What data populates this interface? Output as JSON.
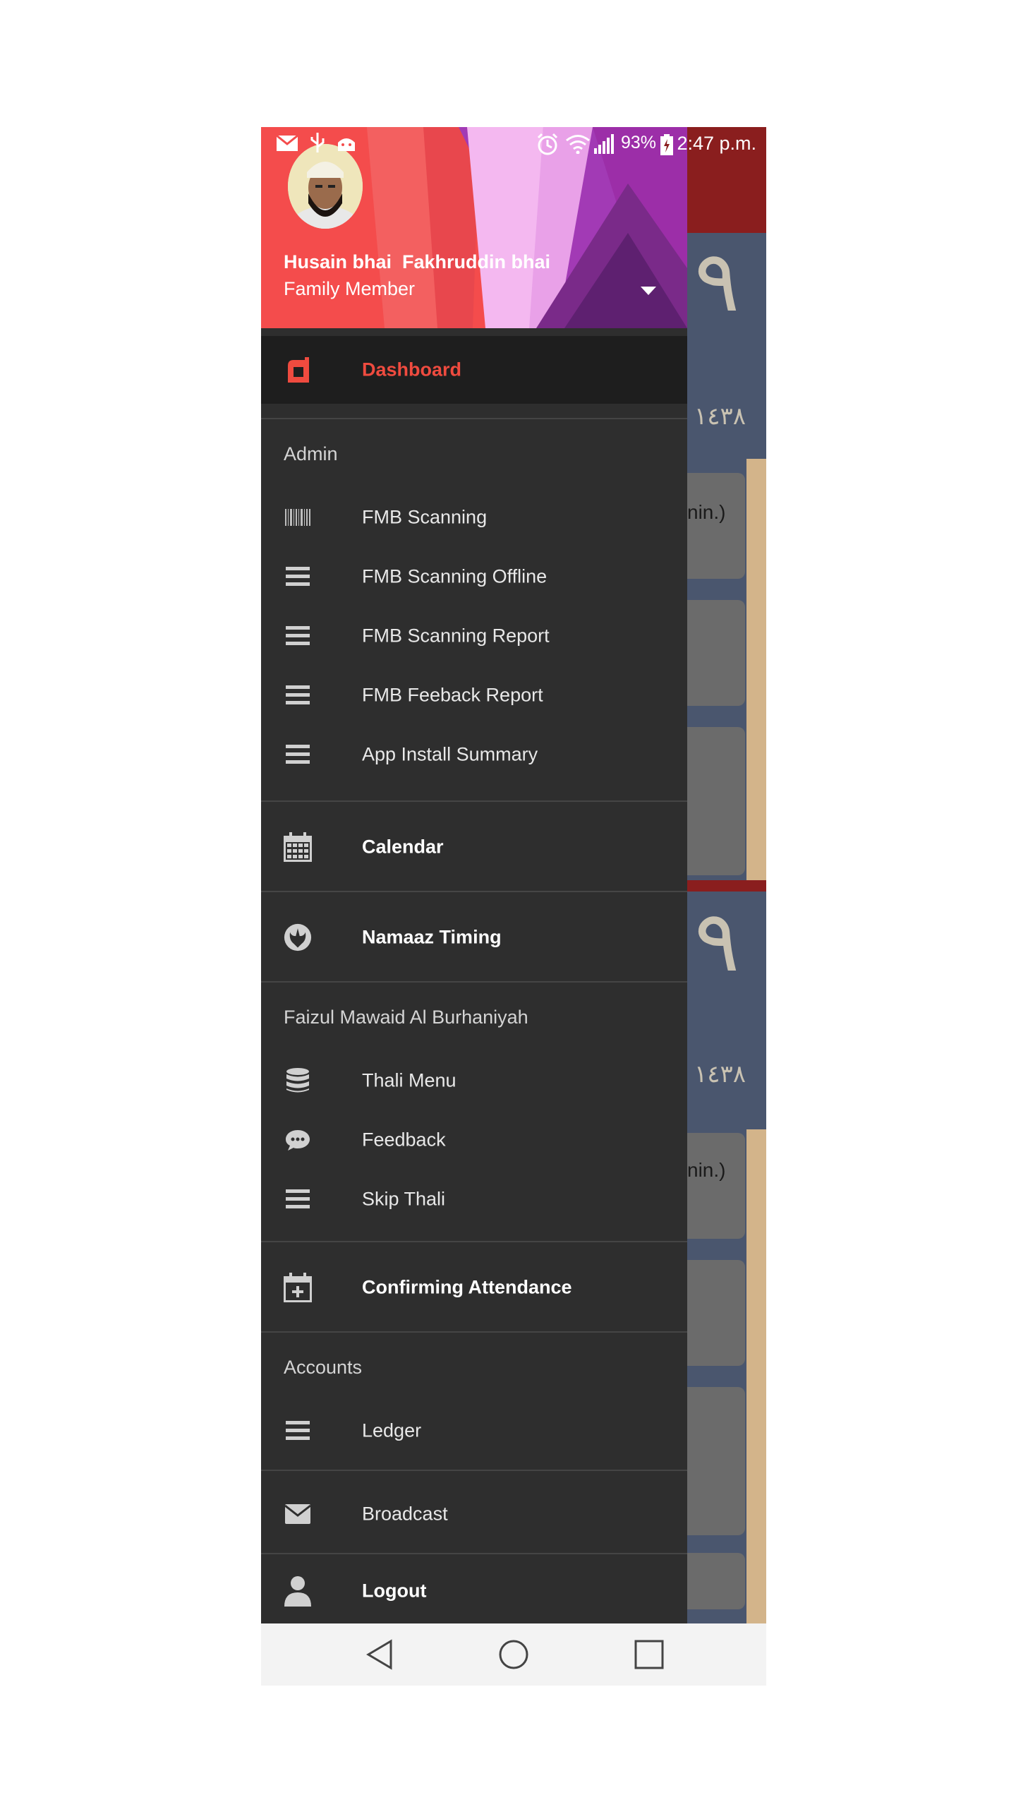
{
  "status_bar": {
    "battery": "93%",
    "time": "2:47 p.m."
  },
  "header": {
    "name": "Husain bhai  Fakhruddin bhai",
    "role": "Family Member"
  },
  "menu": {
    "dashboard": "Dashboard",
    "admin_section": "Admin",
    "fmb_scanning": "FMB Scanning",
    "fmb_scanning_offline": "FMB Scanning Offline",
    "fmb_scanning_report": "FMB Scanning Report",
    "fmb_feedback_report": "FMB Feeback Report",
    "app_install_summary": "App Install Summary",
    "calendar": "Calendar",
    "namaaz_timing": "Namaaz Timing",
    "faiz_section": "Faizul Mawaid Al Burhaniyah",
    "thali_menu": "Thali Menu",
    "feedback": "Feedback",
    "skip_thali": "Skip Thali",
    "confirming_attendance": "Confirming Attendance",
    "accounts_section": "Accounts",
    "ledger": "Ledger",
    "broadcast": "Broadcast",
    "logout": "Logout"
  },
  "background_app": {
    "glyph": "٩",
    "year_text": "١٤٣٨",
    "card_text": "nin.)"
  },
  "colors": {
    "accent": "#ef4b3f",
    "drawer_bg": "#2e2e2e",
    "header_red": "#f44c4c",
    "header_purple": "#a23ab5"
  },
  "icons": {
    "dashboard": "dashboard-logo-icon",
    "scanning": "barcode-icon",
    "list": "hamburger-list-icon",
    "calendar": "calendar-grid-icon",
    "namaaz": "rebel-alliance-icon",
    "thali": "database-stack-icon",
    "feedback": "chat-bubble-icon",
    "attendance": "calendar-plus-icon",
    "broadcast": "envelope-icon",
    "logout": "user-icon"
  }
}
